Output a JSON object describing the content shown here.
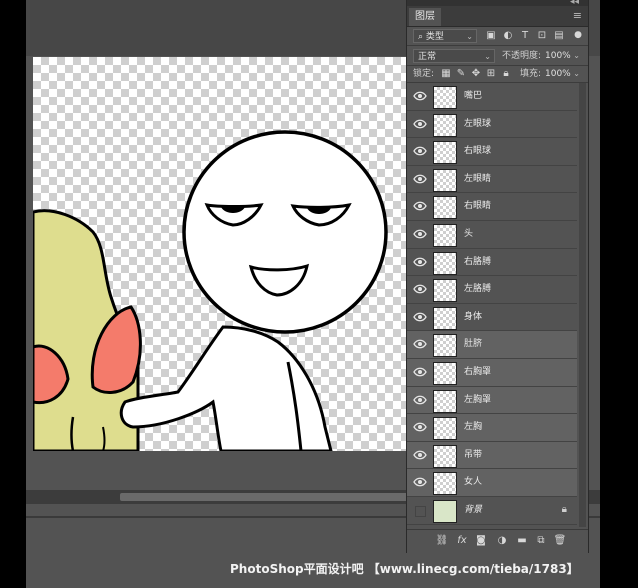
{
  "panel": {
    "tab_label": "图层",
    "collapse_glyph": "◂◂",
    "close_glyph": "✕",
    "menu_icon": "hamburger-icon",
    "filter": {
      "value": "类型",
      "icon": "search-icon"
    },
    "blend_mode": "正常",
    "opacity_label": "不透明度:",
    "opacity_value": "100%",
    "lock_label": "锁定:",
    "fill_label": "填充:",
    "fill_value": "100%",
    "layers": [
      {
        "name": "嘴巴",
        "visible": true,
        "selected": false
      },
      {
        "name": "左眼球",
        "visible": true,
        "selected": false
      },
      {
        "name": "右眼球",
        "visible": true,
        "selected": false
      },
      {
        "name": "左眼睛",
        "visible": true,
        "selected": false
      },
      {
        "name": "右眼睛",
        "visible": true,
        "selected": false
      },
      {
        "name": "头",
        "visible": true,
        "selected": false
      },
      {
        "name": "右胳膊",
        "visible": true,
        "selected": false
      },
      {
        "name": "左胳膊",
        "visible": true,
        "selected": false
      },
      {
        "name": "身体",
        "visible": true,
        "selected": false
      },
      {
        "name": "肚脐",
        "visible": true,
        "selected": true
      },
      {
        "name": "右胸罩",
        "visible": true,
        "selected": true
      },
      {
        "name": "左胸罩",
        "visible": true,
        "selected": true
      },
      {
        "name": "左胸",
        "visible": true,
        "selected": true
      },
      {
        "name": "吊带",
        "visible": true,
        "selected": true
      },
      {
        "name": "女人",
        "visible": true,
        "selected": true
      },
      {
        "name": "背景",
        "visible": false,
        "selected": false,
        "locked": true
      }
    ],
    "footer_icons": [
      "link-icon",
      "fx-icon",
      "mask-icon",
      "adjustment-icon",
      "folder-icon",
      "new-layer-icon",
      "trash-icon"
    ],
    "fx_label": "fx"
  },
  "colors": {
    "app_bg": "#535353",
    "skin_yellow": "#dedd8e",
    "bra_salmon": "#f47b6b"
  },
  "watermark": "PhotoShop平面设计吧 【www.linecg.com/tieba/1783】"
}
